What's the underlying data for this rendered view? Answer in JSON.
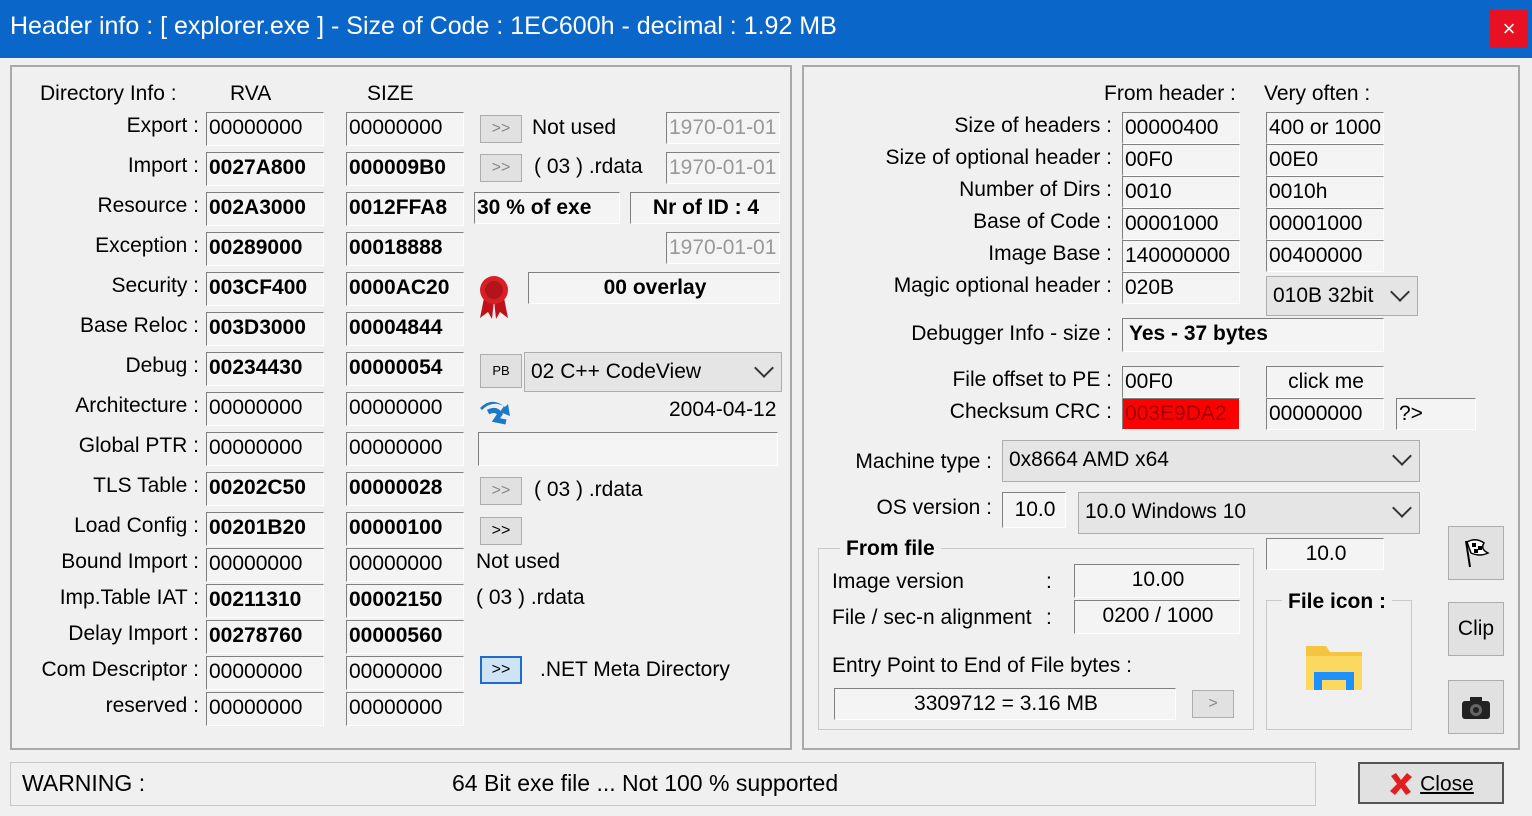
{
  "window": {
    "title": "Header info  : [ explorer.exe ] - Size of Code : 1EC600h - decimal : 1.92 MB",
    "close_glyph": "×"
  },
  "dir": {
    "header": "Directory Info :",
    "rva_header": "RVA",
    "size_header": "SIZE",
    "rows": [
      {
        "label": "Export :",
        "rva": "00000000",
        "size": "00000000"
      },
      {
        "label": "Import :",
        "rva": "0027A800",
        "size": "000009B0"
      },
      {
        "label": "Resource :",
        "rva": "002A3000",
        "size": "0012FFA8"
      },
      {
        "label": "Exception :",
        "rva": "00289000",
        "size": "00018888"
      },
      {
        "label": "Security :",
        "rva": "003CF400",
        "size": "0000AC20"
      },
      {
        "label": "Base Reloc :",
        "rva": "003D3000",
        "size": "00004844"
      },
      {
        "label": "Debug :",
        "rva": "00234430",
        "size": "00000054"
      },
      {
        "label": "Architecture :",
        "rva": "00000000",
        "size": "00000000"
      },
      {
        "label": "Global PTR :",
        "rva": "00000000",
        "size": "00000000"
      },
      {
        "label": "TLS Table :",
        "rva": "00202C50",
        "size": "00000028"
      },
      {
        "label": "Load Config :",
        "rva": "00201B20",
        "size": "00000100"
      },
      {
        "label": "Bound Import :",
        "rva": "00000000",
        "size": "00000000"
      },
      {
        "label": "Imp.Table IAT :",
        "rva": "00211310",
        "size": "00002150"
      },
      {
        "label": "Delay Import :",
        "rva": "00278760",
        "size": "00000560"
      },
      {
        "label": "Com Descriptor :",
        "rva": "00000000",
        "size": "00000000"
      },
      {
        "label": "reserved :",
        "rva": "00000000",
        "size": "00000000"
      }
    ],
    "btn_label": ">>",
    "export_note": "Not used",
    "export_date": "1970-01-01",
    "import_note": "( 03 ) .rdata",
    "import_date": "1970-01-01",
    "resource_pct": "30  % of exe",
    "resource_nr": "Nr of ID : 4",
    "exception_date": "1970-01-01",
    "security_overlay": "00 overlay",
    "debug_pb": "PB",
    "debug_combo": "02  C++ CodeView",
    "arch_date": "2004-04-12",
    "tls_note": "( 03 ) .rdata",
    "bound_note": "Not used",
    "iat_note": "( 03 ) .rdata",
    "com_note": ".NET Meta Directory"
  },
  "header": {
    "from_header": "From header :",
    "very_often": "Very often :",
    "rows": [
      {
        "label": "Size of headers :",
        "value": "00000400",
        "often": "400 or  1000"
      },
      {
        "label": "Size of optional header :",
        "value": "00F0",
        "often": "00E0"
      },
      {
        "label": "Number of Dirs :",
        "value": "0010",
        "often": "0010h"
      },
      {
        "label": "Base of Code :",
        "value": "00001000",
        "often": "00001000"
      },
      {
        "label": "Image Base :",
        "value": "140000000",
        "often": "00400000"
      }
    ],
    "magic_label": "Magic optional header :",
    "magic_value": "020B",
    "magic_combo": "010B 32bit",
    "debugger_label": "Debugger Info  -  size :",
    "debugger_value": "Yes    - 37 bytes",
    "pe_label": "File offset to PE :",
    "pe_value": "00F0",
    "click_me": "click me",
    "crc_label": "Checksum CRC :",
    "crc_value": "003E9DA2",
    "crc_often": "00000000",
    "crc_extra": "?>",
    "machine_label": "Machine type :",
    "machine_value": "0x8664   AMD x64",
    "os_label": "OS version :",
    "os_value": "10.0",
    "os_combo": "10.0 Windows 10",
    "os_extra": "10.0"
  },
  "file": {
    "group_title": "From file",
    "image_version_label": "Image version",
    "image_version_value": "10.00",
    "align_label": "File / sec-n alignment",
    "align_value": "0200   /    1000",
    "colon": ":",
    "entry_label": "Entry Point to End of File bytes :",
    "entry_value": "3309712  =  3.16 MB",
    "entry_btn": ">",
    "icon_title": "File icon :"
  },
  "side": {
    "clip_label": "Clip"
  },
  "status": {
    "warning_label": "WARNING :",
    "warning_text": "64 Bit exe file ... Not 100 % supported",
    "close_label": "Close"
  },
  "colors": {
    "titlebar": "#0a66c8",
    "crc_bg": "#ff0000",
    "close_red": "#e81123"
  }
}
